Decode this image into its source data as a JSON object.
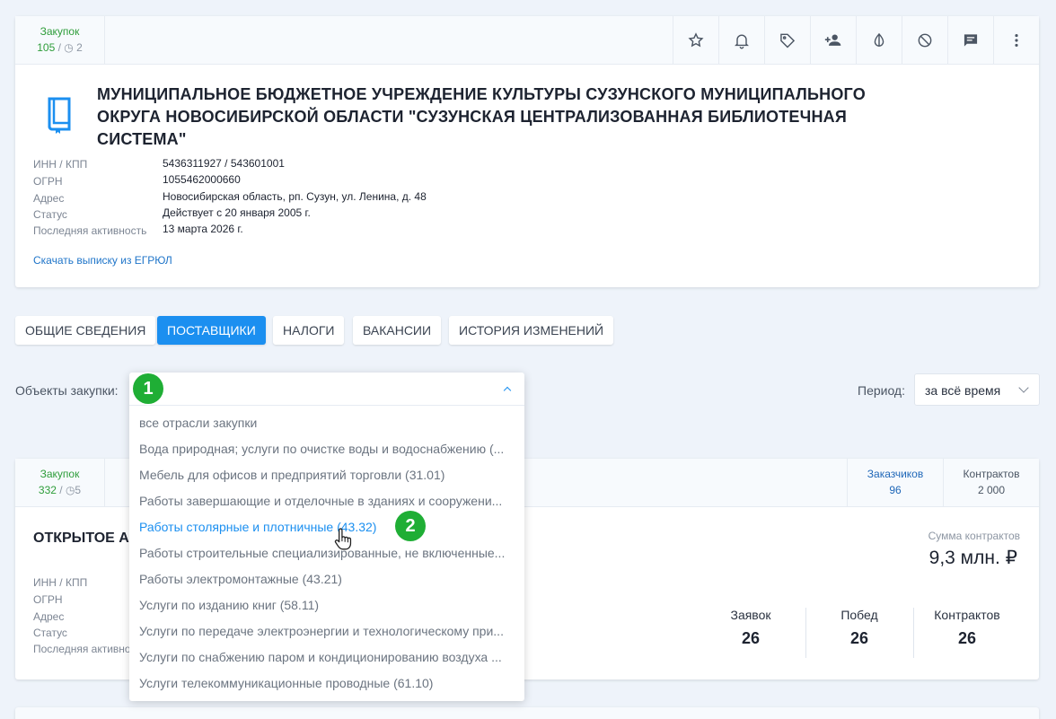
{
  "top_card": {
    "stat_label": "Закупок",
    "stat_value": "105",
    "stat_extra": "2",
    "tools": [
      "star-icon",
      "bell-icon",
      "tag-icon",
      "add-person-icon",
      "contrast-icon",
      "block-icon",
      "comment-icon",
      "more-icon"
    ],
    "org_name": "МУНИЦИПАЛЬНОЕ БЮДЖЕТНОЕ УЧРЕЖДЕНИЕ КУЛЬТУРЫ СУЗУНСКОГО МУНИЦИПАЛЬНОГО ОКРУГА НОВОСИБИРСКОЙ ОБЛАСТИ \"СУЗУНСКАЯ ЦЕНТРАЛИЗОВАННАЯ БИБЛИОТЕЧНАЯ СИСТЕМА\"",
    "details": [
      {
        "k": "ИНН / КПП",
        "v": "5436311927 / 543601001"
      },
      {
        "k": "ОГРН",
        "v": "1055462000660"
      },
      {
        "k": "Адрес",
        "v": "Новосибирская область, рп. Сузун, ул. Ленина, д. 48"
      },
      {
        "k": "Статус",
        "v": "Действует с 20 января 2005 г."
      },
      {
        "k": "Последняя активность",
        "v": "13 марта 2026 г."
      }
    ],
    "egrul_link": "Скачать выписку из ЕГРЮЛ"
  },
  "tabs": [
    "ОБЩИЕ СВЕДЕНИЯ",
    "ПОСТАВЩИКИ",
    "НАЛОГИ",
    "ВАКАНСИИ",
    "ИСТОРИЯ ИЗМЕНЕНИЙ"
  ],
  "active_tab": "ПОСТАВЩИКИ",
  "filters": {
    "objects_label": "Объекты закупки:",
    "period_label": "Период:",
    "period_value": "за всё время"
  },
  "dropdown": {
    "items": [
      "все отрасли закупки",
      "Вода природная; услуги по очистке воды и водоснабжению (...",
      "Мебель для офисов и предприятий торговли (31.01)",
      "Работы завершающие и отделочные в зданиях и сооружени...",
      "Работы столярные и плотничные (43.32)",
      "Работы строительные специализированные, не включенные...",
      "Работы электромонтажные (43.21)",
      "Услуги по изданию книг (58.11)",
      "Услуги по передаче электроэнергии и технологическому при...",
      "Услуги по снабжению паром и кондиционированию воздуха ...",
      "Услуги телекоммуникационные проводные (61.10)"
    ],
    "selected_index": 4
  },
  "markers": [
    "1",
    "2"
  ],
  "second_card": {
    "stat_label": "Закупок",
    "stat_value": "332",
    "stat_extra": "5",
    "customers_label": "Заказчиков",
    "customers_value": "96",
    "contracts_label": "Контрактов",
    "contracts_value": "2 000",
    "title": "ОТКРЫТОЕ АК",
    "detail_labels": [
      "ИНН / КПП",
      "ОГРН",
      "Адрес",
      "Статус",
      "Последняя активно"
    ],
    "sum_label": "Сумма контрактов",
    "sum_value": "9,3 млн. ₽",
    "counts": [
      {
        "label": "Заявок",
        "value": "26"
      },
      {
        "label": "Побед",
        "value": "26"
      },
      {
        "label": "Контрактов",
        "value": "26"
      }
    ]
  }
}
